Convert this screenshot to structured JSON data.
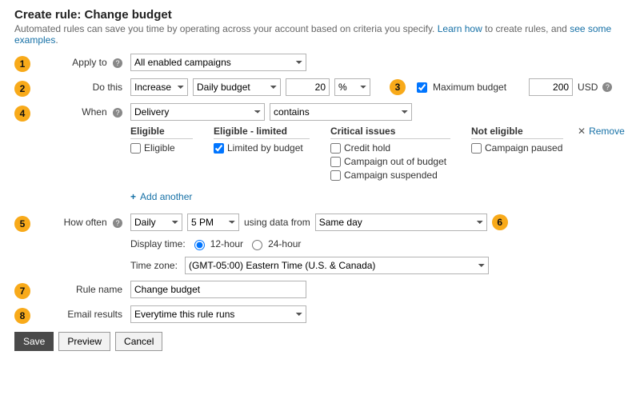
{
  "title": "Create rule: Change budget",
  "subtitle_prefix": "Automated rules can save you time by operating across your account based on criteria you specify. ",
  "link_learn": "Learn how",
  "subtitle_mid": " to create rules, and ",
  "link_examples": "see some examples",
  "badges": {
    "apply": "1",
    "do": "2",
    "max": "3",
    "when": "4",
    "how": "5",
    "using": "6",
    "rulename": "7",
    "email": "8"
  },
  "labels": {
    "apply_to": "Apply to",
    "do_this": "Do this",
    "when": "When",
    "how_often": "How often",
    "display_time": "Display time:",
    "time_zone": "Time zone:",
    "rule_name": "Rule name",
    "email_results": "Email results",
    "using_data": "using data from"
  },
  "apply_to_value": "All enabled campaigns",
  "do_this": {
    "action": "Increase",
    "target": "Daily budget",
    "amount": "20",
    "unit": "%"
  },
  "max_budget": {
    "label": "Maximum budget",
    "value": "200",
    "currency": "USD"
  },
  "when": {
    "metric": "Delivery",
    "op": "contains"
  },
  "cols": {
    "eligible": {
      "h": "Eligible",
      "items": [
        {
          "l": "Eligible",
          "c": false
        }
      ]
    },
    "eligible_limited": {
      "h": "Eligible - limited",
      "items": [
        {
          "l": "Limited by budget",
          "c": true
        }
      ]
    },
    "critical": {
      "h": "Critical issues",
      "items": [
        {
          "l": "Credit hold",
          "c": false
        },
        {
          "l": "Campaign out of budget",
          "c": false
        },
        {
          "l": "Campaign suspended",
          "c": false
        }
      ]
    },
    "not_eligible": {
      "h": "Not eligible",
      "items": [
        {
          "l": "Campaign paused",
          "c": false
        }
      ]
    }
  },
  "remove_label": "Remove",
  "add_another": "Add another",
  "how_often": {
    "freq": "Daily",
    "time": "5 PM",
    "data_range": "Same day",
    "hour12": "12-hour",
    "hour24": "24-hour",
    "tz": "(GMT-05:00) Eastern Time (U.S. & Canada)"
  },
  "rule_name_value": "Change budget",
  "email_value": "Everytime this rule runs",
  "buttons": {
    "save": "Save",
    "preview": "Preview",
    "cancel": "Cancel"
  }
}
